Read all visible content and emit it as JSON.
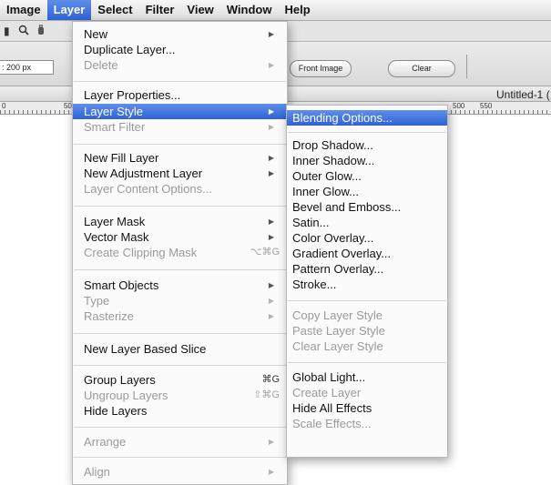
{
  "menubar": {
    "items": [
      {
        "label": "Image",
        "active": false
      },
      {
        "label": "Layer",
        "active": true
      },
      {
        "label": "Select",
        "active": false
      },
      {
        "label": "Filter",
        "active": false
      },
      {
        "label": "View",
        "active": false
      },
      {
        "label": "Window",
        "active": false
      },
      {
        "label": "Help",
        "active": false
      }
    ]
  },
  "options": {
    "size_value": ": 200 px",
    "front_image_label": "Front Image",
    "clear_label": "Clear"
  },
  "document": {
    "title": "Untitled-1 (",
    "ruler_numbers": [
      "0",
      "50",
      "500",
      "550"
    ]
  },
  "layer_menu": {
    "items": [
      {
        "label": "New",
        "state": "enabled",
        "submenu": true
      },
      {
        "label": "Duplicate Layer...",
        "state": "enabled"
      },
      {
        "label": "Delete",
        "state": "disabled",
        "submenu": true
      },
      {
        "label": "Layer Properties...",
        "state": "enabled"
      },
      {
        "label": "Layer Style",
        "state": "highlighted",
        "submenu": true
      },
      {
        "label": "Smart Filter",
        "state": "disabled",
        "submenu": true
      },
      {
        "label": "New Fill Layer",
        "state": "enabled",
        "submenu": true
      },
      {
        "label": "New Adjustment Layer",
        "state": "enabled",
        "submenu": true
      },
      {
        "label": "Layer Content Options...",
        "state": "disabled"
      },
      {
        "label": "Layer Mask",
        "state": "enabled",
        "submenu": true
      },
      {
        "label": "Vector Mask",
        "state": "enabled",
        "submenu": true
      },
      {
        "label": "Create Clipping Mask",
        "state": "disabled",
        "shortcut": "⌥⌘G"
      },
      {
        "label": "Smart Objects",
        "state": "enabled",
        "submenu": true
      },
      {
        "label": "Type",
        "state": "disabled",
        "submenu": true
      },
      {
        "label": "Rasterize",
        "state": "disabled",
        "submenu": true
      },
      {
        "label": "New Layer Based Slice",
        "state": "enabled"
      },
      {
        "label": "Group Layers",
        "state": "enabled",
        "shortcut": "⌘G"
      },
      {
        "label": "Ungroup Layers",
        "state": "disabled",
        "shortcut": "⇧⌘G"
      },
      {
        "label": "Hide Layers",
        "state": "enabled"
      },
      {
        "label": "Arrange",
        "state": "disabled",
        "submenu": true
      },
      {
        "label": "Align",
        "state": "disabled",
        "submenu": true
      }
    ]
  },
  "layer_style_submenu": {
    "items": [
      {
        "label": "Blending Options...",
        "state": "highlighted"
      },
      {
        "label": "Drop Shadow...",
        "state": "enabled"
      },
      {
        "label": "Inner Shadow...",
        "state": "enabled"
      },
      {
        "label": "Outer Glow...",
        "state": "enabled"
      },
      {
        "label": "Inner Glow...",
        "state": "enabled"
      },
      {
        "label": "Bevel and Emboss...",
        "state": "enabled"
      },
      {
        "label": "Satin...",
        "state": "enabled"
      },
      {
        "label": "Color Overlay...",
        "state": "enabled"
      },
      {
        "label": "Gradient Overlay...",
        "state": "enabled"
      },
      {
        "label": "Pattern Overlay...",
        "state": "enabled"
      },
      {
        "label": "Stroke...",
        "state": "enabled"
      },
      {
        "label": "Copy Layer Style",
        "state": "disabled"
      },
      {
        "label": "Paste Layer Style",
        "state": "disabled"
      },
      {
        "label": "Clear Layer Style",
        "state": "disabled"
      },
      {
        "label": "Global Light...",
        "state": "enabled"
      },
      {
        "label": "Create Layer",
        "state": "disabled"
      },
      {
        "label": "Hide All Effects",
        "state": "enabled"
      },
      {
        "label": "Scale Effects...",
        "state": "disabled"
      }
    ]
  },
  "icons": {
    "submenu_arrow": "▶",
    "zoom_tool": "magnifier-icon",
    "hand_tool": "hand-icon"
  },
  "colors": {
    "highlight": "#3a6ddc",
    "disabled_text": "#9a9a9a"
  }
}
